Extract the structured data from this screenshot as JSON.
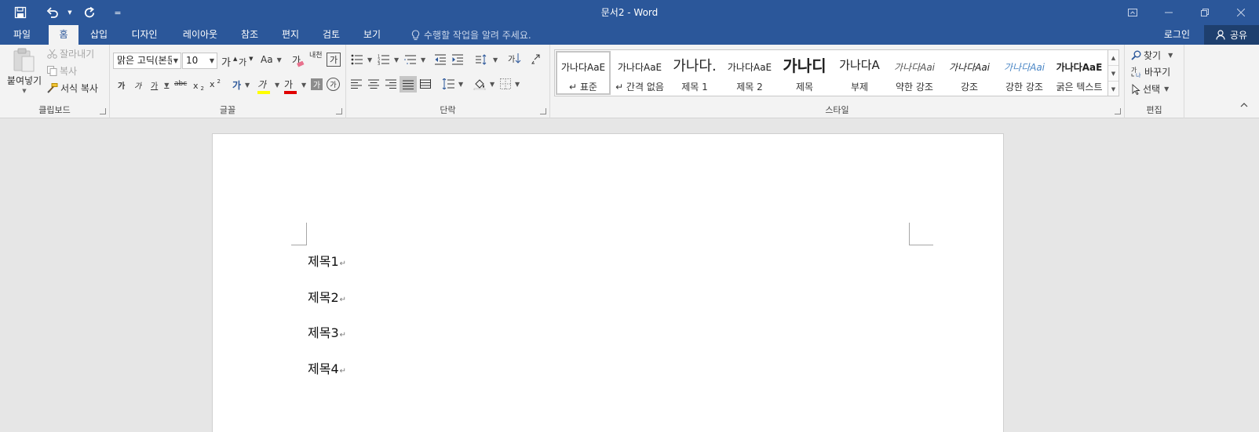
{
  "title_bar": {
    "title": "문서2 - Word"
  },
  "qat": {
    "customize_label": "="
  },
  "tabs": [
    {
      "label": "파일"
    },
    {
      "label": "홈"
    },
    {
      "label": "삽입"
    },
    {
      "label": "디자인"
    },
    {
      "label": "레이아웃"
    },
    {
      "label": "참조"
    },
    {
      "label": "편지"
    },
    {
      "label": "검토"
    },
    {
      "label": "보기"
    }
  ],
  "tell_me": {
    "placeholder": "수행할 작업을 알려 주세요."
  },
  "account": {
    "login_label": "로그인",
    "share_label": "공유"
  },
  "clipboard": {
    "group_label": "클립보드",
    "paste_label": "붙여넣기",
    "cut_label": "잘라내기",
    "copy_label": "복사",
    "format_painter_label": "서식 복사"
  },
  "font": {
    "group_label": "글꼴",
    "font_name": "맑은 고딕(본둔",
    "font_size": "10",
    "grow_label": "가",
    "shrink_label": "가",
    "case_label": "Aa",
    "clear_label": "가",
    "phonetic_label": "내천",
    "border_char_label": "가",
    "bold_label": "가",
    "italic_label": "가",
    "underline_label": "가",
    "strike_label": "abc",
    "subscript_label": "x",
    "superscript_label": "x",
    "effects_label": "가",
    "highlight_label": "가",
    "font_color_label": "가",
    "shading_label": "가",
    "enclose_label": "가"
  },
  "paragraph": {
    "group_label": "단락",
    "sort_label": "가"
  },
  "styles": {
    "group_label": "스타일",
    "items": [
      {
        "sample": "가나다AaE",
        "name": "↵ 표준",
        "selected": true
      },
      {
        "sample": "가나다AaE",
        "name": "↵ 간격 없음"
      },
      {
        "sample": "가나다.",
        "name": "제목 1"
      },
      {
        "sample": "가나다AaE",
        "name": "제목 2"
      },
      {
        "sample": "가나디",
        "name": "제목"
      },
      {
        "sample": "가나다A",
        "name": "부제"
      },
      {
        "sample": "가나다Aai",
        "name": "약한 강조"
      },
      {
        "sample": "가나다Aai",
        "name": "강조"
      },
      {
        "sample": "가나다Aai",
        "name": "강한 강조"
      },
      {
        "sample": "가나다AaE",
        "name": "굵은 텍스트"
      }
    ]
  },
  "editing": {
    "group_label": "편집",
    "find_label": "찾기",
    "replace_label": "바꾸기",
    "select_label": "선택"
  },
  "document": {
    "paragraphs": [
      {
        "text": "제목1"
      },
      {
        "text": "제목2"
      },
      {
        "text": "제목3"
      },
      {
        "text": "제목4"
      }
    ],
    "paragraph_mark": "↵"
  },
  "colors": {
    "brand_blue": "#2b579a",
    "ribbon_bg": "#f3f3f3",
    "highlight_yellow": "#ffff00",
    "font_red": "#e00000"
  }
}
